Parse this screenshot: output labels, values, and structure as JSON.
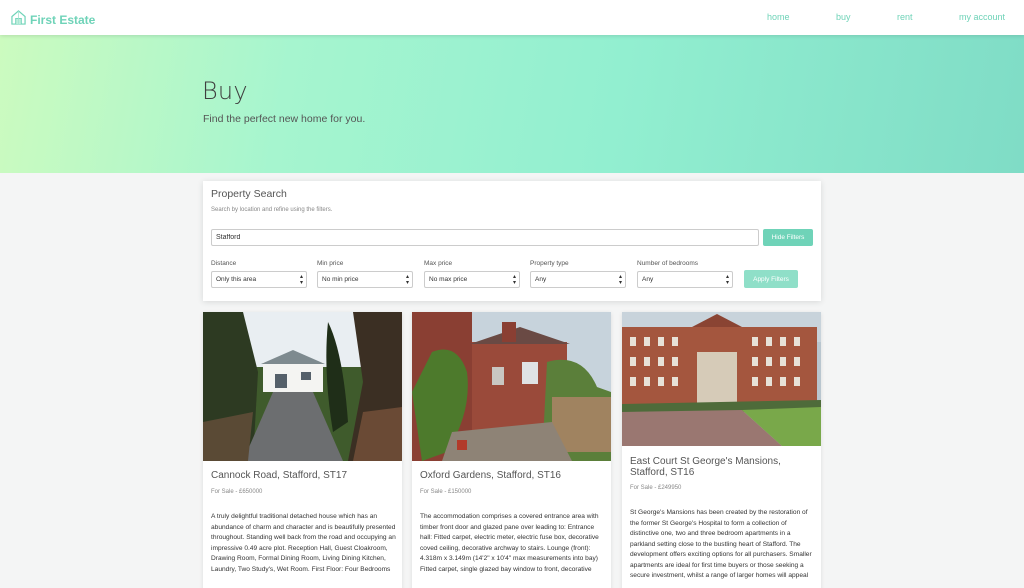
{
  "nav": {
    "brand": "First Estate",
    "links": [
      "home",
      "buy",
      "rent",
      "my account"
    ]
  },
  "hero": {
    "title": "Buy",
    "subtitle": "Find the perfect new home for you."
  },
  "search": {
    "title": "Property Search",
    "description": "Search by location and refine using the filters.",
    "query": "Stafford",
    "hide_filters": "Hide Filters",
    "apply_filters": "Apply Filters",
    "filters": [
      {
        "label": "Distance",
        "value": "Only this area"
      },
      {
        "label": "Min price",
        "value": "No min price"
      },
      {
        "label": "Max price",
        "value": "No max price"
      },
      {
        "label": "Property type",
        "value": "Any"
      },
      {
        "label": "Number of bedrooms",
        "value": "Any"
      }
    ]
  },
  "listings": [
    {
      "title": "Cannock Road, Stafford, ST17",
      "price": "For Sale - £650000",
      "description": "A truly delightful traditional detached house which has an abundance of charm and character and is beautifully presented throughout. Standing well back from the road and occupying an impressive 0.49 acre plot. Reception Hall, Guest Cloakroom, Drawing Room, Formal Dining Room, Living Dining Kitchen, Laundry, Two Study's, Wet Room. First Floor: Four Bedrooms"
    },
    {
      "title": "Oxford Gardens, Stafford, ST16",
      "price": "For Sale - £150000",
      "description": "The accommodation comprises a covered entrance area with timber front door and glazed pane over leading to: Entrance hall: Fitted carpet, electric meter, electric fuse box, decorative coved ceiling, decorative archway to stairs. Lounge (front): 4.318m x 3.149m (14'2\" x 10'4\" max measurements into bay) Fitted carpet, single glazed bay window to front, decorative"
    },
    {
      "title": "East Court St George's Mansions, Stafford, ST16",
      "price": "For Sale - £249950",
      "description": "St George's Mansions has been created by the restoration of the former St George's Hospital to form a collection of distinctive one, two and three bedroom apartments in a parkland setting close to the bustling heart of Stafford. The development offers exciting options for all purchasers. Smaller apartments are ideal for first time buyers or those seeking a secure investment, whilst a range of larger homes will appeal"
    }
  ],
  "colors": {
    "accent": "#6fd3b8",
    "hero_gradient_start": "#ccfbbf",
    "hero_gradient_end": "#7fdcc6"
  },
  "icons": {
    "brand": "house-logo-icon",
    "select": "updown-arrow-icon"
  }
}
